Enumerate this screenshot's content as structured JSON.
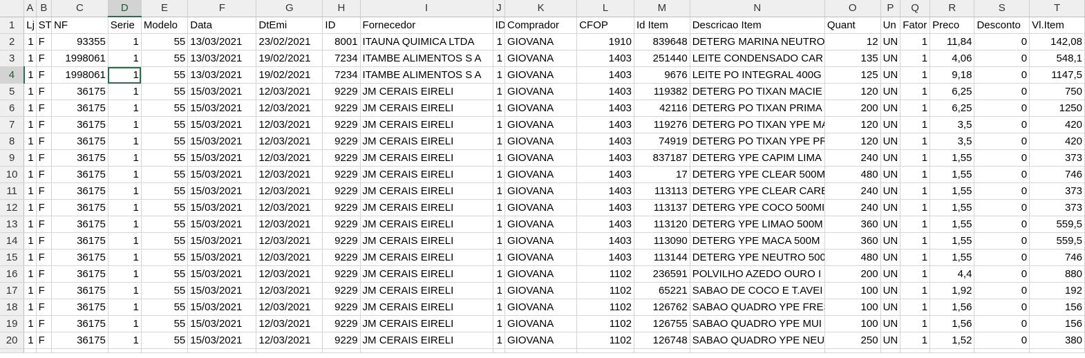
{
  "columns": [
    "A",
    "B",
    "C",
    "D",
    "E",
    "F",
    "G",
    "H",
    "I",
    "J",
    "K",
    "L",
    "M",
    "N",
    "O",
    "P",
    "Q",
    "R",
    "S",
    "T"
  ],
  "headers": [
    "Lj",
    "ST",
    "NF",
    "Serie",
    "Modelo",
    "Data",
    "DtEmi",
    "ID",
    "Fornecedor",
    "ID",
    "Comprador",
    "CFOP",
    "Id Item",
    "Descricao Item",
    "Quant",
    "Un",
    "Fator",
    "Preco",
    "Desconto",
    "Vl.Item"
  ],
  "rows": [
    [
      "1",
      "F",
      "93355",
      "1",
      "55",
      "13/03/2021",
      "23/02/2021",
      "8001",
      "ITAUNA QUIMICA LTDA",
      "1",
      "GIOVANA",
      "1910",
      "839648",
      "DETERG MARINA NEUTRO",
      "12",
      "UN",
      "1",
      "11,84",
      "0",
      "142,08"
    ],
    [
      "1",
      "F",
      "1998061",
      "1",
      "55",
      "13/03/2021",
      "19/02/2021",
      "7234",
      "ITAMBE ALIMENTOS S A",
      "1",
      "GIOVANA",
      "1403",
      "251440",
      "LEITE CONDENSADO CAR",
      "135",
      "UN",
      "1",
      "4,06",
      "0",
      "548,1"
    ],
    [
      "1",
      "F",
      "1998061",
      "1",
      "55",
      "13/03/2021",
      "19/02/2021",
      "7234",
      "ITAMBE ALIMENTOS S A",
      "1",
      "GIOVANA",
      "1403",
      "9676",
      "LEITE PO INTEGRAL 400G",
      "125",
      "UN",
      "1",
      "9,18",
      "0",
      "1147,5"
    ],
    [
      "1",
      "F",
      "36175",
      "1",
      "55",
      "15/03/2021",
      "12/03/2021",
      "9229",
      "JM CERAIS EIRELI",
      "1",
      "GIOVANA",
      "1403",
      "119382",
      "DETERG PO TIXAN MACIE",
      "120",
      "UN",
      "1",
      "6,25",
      "0",
      "750"
    ],
    [
      "1",
      "F",
      "36175",
      "1",
      "55",
      "15/03/2021",
      "12/03/2021",
      "9229",
      "JM CERAIS EIRELI",
      "1",
      "GIOVANA",
      "1403",
      "42116",
      "DETERG PO TIXAN PRIMA",
      "200",
      "UN",
      "1",
      "6,25",
      "0",
      "1250"
    ],
    [
      "1",
      "F",
      "36175",
      "1",
      "55",
      "15/03/2021",
      "12/03/2021",
      "9229",
      "JM CERAIS EIRELI",
      "1",
      "GIOVANA",
      "1403",
      "119276",
      "DETERG PO TIXAN YPE MA",
      "120",
      "UN",
      "1",
      "3,5",
      "0",
      "420"
    ],
    [
      "1",
      "F",
      "36175",
      "1",
      "55",
      "15/03/2021",
      "12/03/2021",
      "9229",
      "JM CERAIS EIRELI",
      "1",
      "GIOVANA",
      "1403",
      "74919",
      "DETERG PO TIXAN YPE PR",
      "120",
      "UN",
      "1",
      "3,5",
      "0",
      "420"
    ],
    [
      "1",
      "F",
      "36175",
      "1",
      "55",
      "15/03/2021",
      "12/03/2021",
      "9229",
      "JM CERAIS EIRELI",
      "1",
      "GIOVANA",
      "1403",
      "837187",
      "DETERG YPE CAPIM LIMA",
      "240",
      "UN",
      "1",
      "1,55",
      "0",
      "373"
    ],
    [
      "1",
      "F",
      "36175",
      "1",
      "55",
      "15/03/2021",
      "12/03/2021",
      "9229",
      "JM CERAIS EIRELI",
      "1",
      "GIOVANA",
      "1403",
      "17",
      "DETERG YPE CLEAR 500M",
      "480",
      "UN",
      "1",
      "1,55",
      "0",
      "746"
    ],
    [
      "1",
      "F",
      "36175",
      "1",
      "55",
      "15/03/2021",
      "12/03/2021",
      "9229",
      "JM CERAIS EIRELI",
      "1",
      "GIOVANA",
      "1403",
      "113113",
      "DETERG YPE CLEAR CARE",
      "240",
      "UN",
      "1",
      "1,55",
      "0",
      "373"
    ],
    [
      "1",
      "F",
      "36175",
      "1",
      "55",
      "15/03/2021",
      "12/03/2021",
      "9229",
      "JM CERAIS EIRELI",
      "1",
      "GIOVANA",
      "1403",
      "113137",
      "DETERG YPE COCO 500MI",
      "240",
      "UN",
      "1",
      "1,55",
      "0",
      "373"
    ],
    [
      "1",
      "F",
      "36175",
      "1",
      "55",
      "15/03/2021",
      "12/03/2021",
      "9229",
      "JM CERAIS EIRELI",
      "1",
      "GIOVANA",
      "1403",
      "113120",
      "DETERG YPE LIMAO 500M",
      "360",
      "UN",
      "1",
      "1,55",
      "0",
      "559,5"
    ],
    [
      "1",
      "F",
      "36175",
      "1",
      "55",
      "15/03/2021",
      "12/03/2021",
      "9229",
      "JM CERAIS EIRELI",
      "1",
      "GIOVANA",
      "1403",
      "113090",
      "DETERG YPE MACA 500M",
      "360",
      "UN",
      "1",
      "1,55",
      "0",
      "559,5"
    ],
    [
      "1",
      "F",
      "36175",
      "1",
      "55",
      "15/03/2021",
      "12/03/2021",
      "9229",
      "JM CERAIS EIRELI",
      "1",
      "GIOVANA",
      "1403",
      "113144",
      "DETERG YPE NEUTRO 500",
      "480",
      "UN",
      "1",
      "1,55",
      "0",
      "746"
    ],
    [
      "1",
      "F",
      "36175",
      "1",
      "55",
      "15/03/2021",
      "12/03/2021",
      "9229",
      "JM CERAIS EIRELI",
      "1",
      "GIOVANA",
      "1102",
      "236591",
      "POLVILHO AZEDO OURO I",
      "200",
      "UN",
      "1",
      "4,4",
      "0",
      "880"
    ],
    [
      "1",
      "F",
      "36175",
      "1",
      "55",
      "15/03/2021",
      "12/03/2021",
      "9229",
      "JM CERAIS EIRELI",
      "1",
      "GIOVANA",
      "1102",
      "65221",
      "SABAO DE COCO E T.AVEI",
      "100",
      "UN",
      "1",
      "1,92",
      "0",
      "192"
    ],
    [
      "1",
      "F",
      "36175",
      "1",
      "55",
      "15/03/2021",
      "12/03/2021",
      "9229",
      "JM CERAIS EIRELI",
      "1",
      "GIOVANA",
      "1102",
      "126762",
      "SABAO QUADRO YPE FRES",
      "100",
      "UN",
      "1",
      "1,56",
      "0",
      "156"
    ],
    [
      "1",
      "F",
      "36175",
      "1",
      "55",
      "15/03/2021",
      "12/03/2021",
      "9229",
      "JM CERAIS EIRELI",
      "1",
      "GIOVANA",
      "1102",
      "126755",
      "SABAO QUADRO YPE MUI",
      "100",
      "UN",
      "1",
      "1,56",
      "0",
      "156"
    ],
    [
      "1",
      "F",
      "36175",
      "1",
      "55",
      "15/03/2021",
      "12/03/2021",
      "9229",
      "JM CERAIS EIRELI",
      "1",
      "GIOVANA",
      "1102",
      "126748",
      "SABAO QUADRO YPE NEU",
      "250",
      "UN",
      "1",
      "1,52",
      "0",
      "380"
    ]
  ],
  "selection": {
    "column": "D",
    "row": "4"
  },
  "colors": {
    "accent": "#217346",
    "header_bg": "#efefef",
    "selected_header_bg": "#d3d3d3",
    "gridline": "#d4d4d4"
  }
}
